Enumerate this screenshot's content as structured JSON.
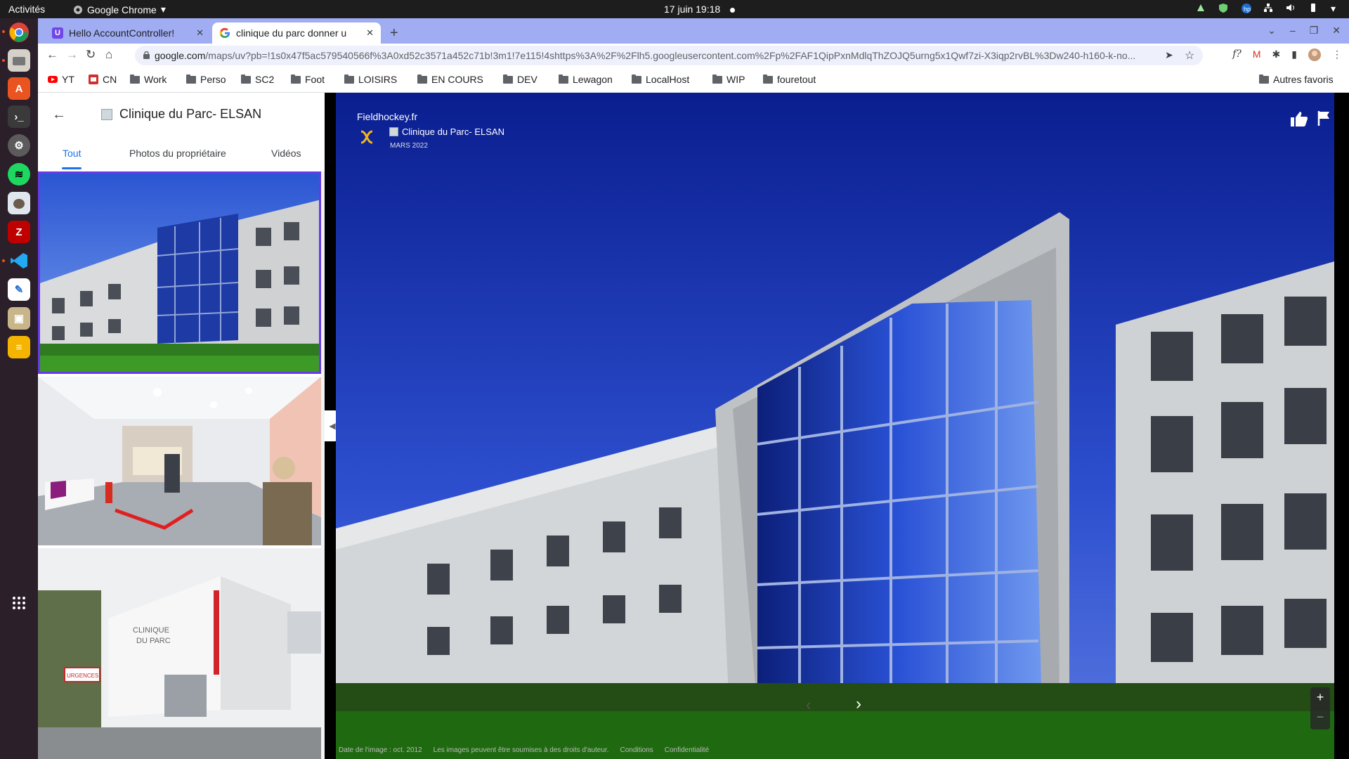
{
  "system": {
    "activities": "Activités",
    "app_name": "Google Chrome",
    "clock": "17 juin  19:18"
  },
  "browser": {
    "tabs": [
      {
        "title": "Hello AccountController!",
        "active": false
      },
      {
        "title": "clinique du parc donner u",
        "active": true
      }
    ],
    "new_tab": "+",
    "url_host": "google.com",
    "url_rest": "/maps/uv?pb=!1s0x47f5ac579540566f%3A0xd52c3571a452c71b!3m1!7e115!4shttps%3A%2F%2Flh5.googleusercontent.com%2Fp%2FAF1QipPxnMdlqThZOJQ5urng5x1Qwf7zi-X3iqp2rvBL%3Dw240-h160-k-no...",
    "bookmarks": [
      "YT",
      "CN",
      "Work",
      "Perso",
      "SC2",
      "Foot",
      "LOISIRS",
      "EN COURS",
      "DEV",
      "Lewagon",
      "LocalHost",
      "WIP",
      "fouretout"
    ],
    "other_bookmarks": "Autres favoris"
  },
  "maps": {
    "place_title": "Clinique du Parc- ELSAN",
    "photo_tabs": [
      "Tout",
      "Photos du propriétaire",
      "Vidéos"
    ],
    "active_photo_tab": 0,
    "viewer": {
      "author": "Fieldhockey.fr",
      "place": "Clinique du Parc- ELSAN",
      "date": "MARS 2022",
      "footer": [
        "Date de l'image : oct. 2012",
        "Les images peuvent être soumises à des droits d'auteur.",
        "Conditions",
        "Confidentialité"
      ],
      "zoom_in": "+",
      "zoom_out": "−"
    }
  },
  "colors": {
    "tabstrip": "#a0adf3",
    "dock": "#2b1f2a",
    "accent": "#1a73e8",
    "selected_thumb": "#673ae8"
  },
  "icons": [
    "back-arrow-icon",
    "thumbs-up-icon",
    "flag-icon",
    "chevron-left-icon",
    "chevron-right-icon",
    "folder-icon",
    "star-icon",
    "extensions-icon",
    "lock-icon"
  ]
}
